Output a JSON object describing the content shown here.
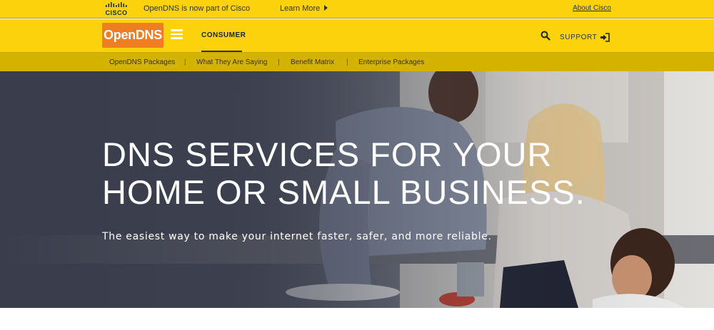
{
  "topbar": {
    "brand": "CISCO",
    "notice": "OpenDNS is now part of Cisco",
    "learn_more": "Learn More",
    "about_link": "About Cisco"
  },
  "navbar": {
    "brand": "OpenDNS",
    "consumer": "CONSUMER",
    "support": "SUPPORT",
    "icons": [
      "hamburger-menu-icon",
      "search-icon",
      "sign-in-icon"
    ]
  },
  "subnav": {
    "items": [
      {
        "label": "OpenDNS Packages"
      },
      {
        "label": "What They Are Saying"
      },
      {
        "label": "Benefit Matrix"
      },
      {
        "label": "Enterprise Packages"
      }
    ],
    "separator": "|"
  },
  "hero": {
    "title_line1": "DNS SERVICES FOR YOUR",
    "title_line2": "HOME OR SMALL BUSINESS.",
    "subtitle": "The easiest way to make your internet faster, safer, and more reliable."
  },
  "colors": {
    "brand_yellow": "#fcd20c",
    "subnav_yellow": "#d4b200",
    "opendns_orange": "#ef7d22",
    "hero_dark": "#3a3e4c"
  }
}
